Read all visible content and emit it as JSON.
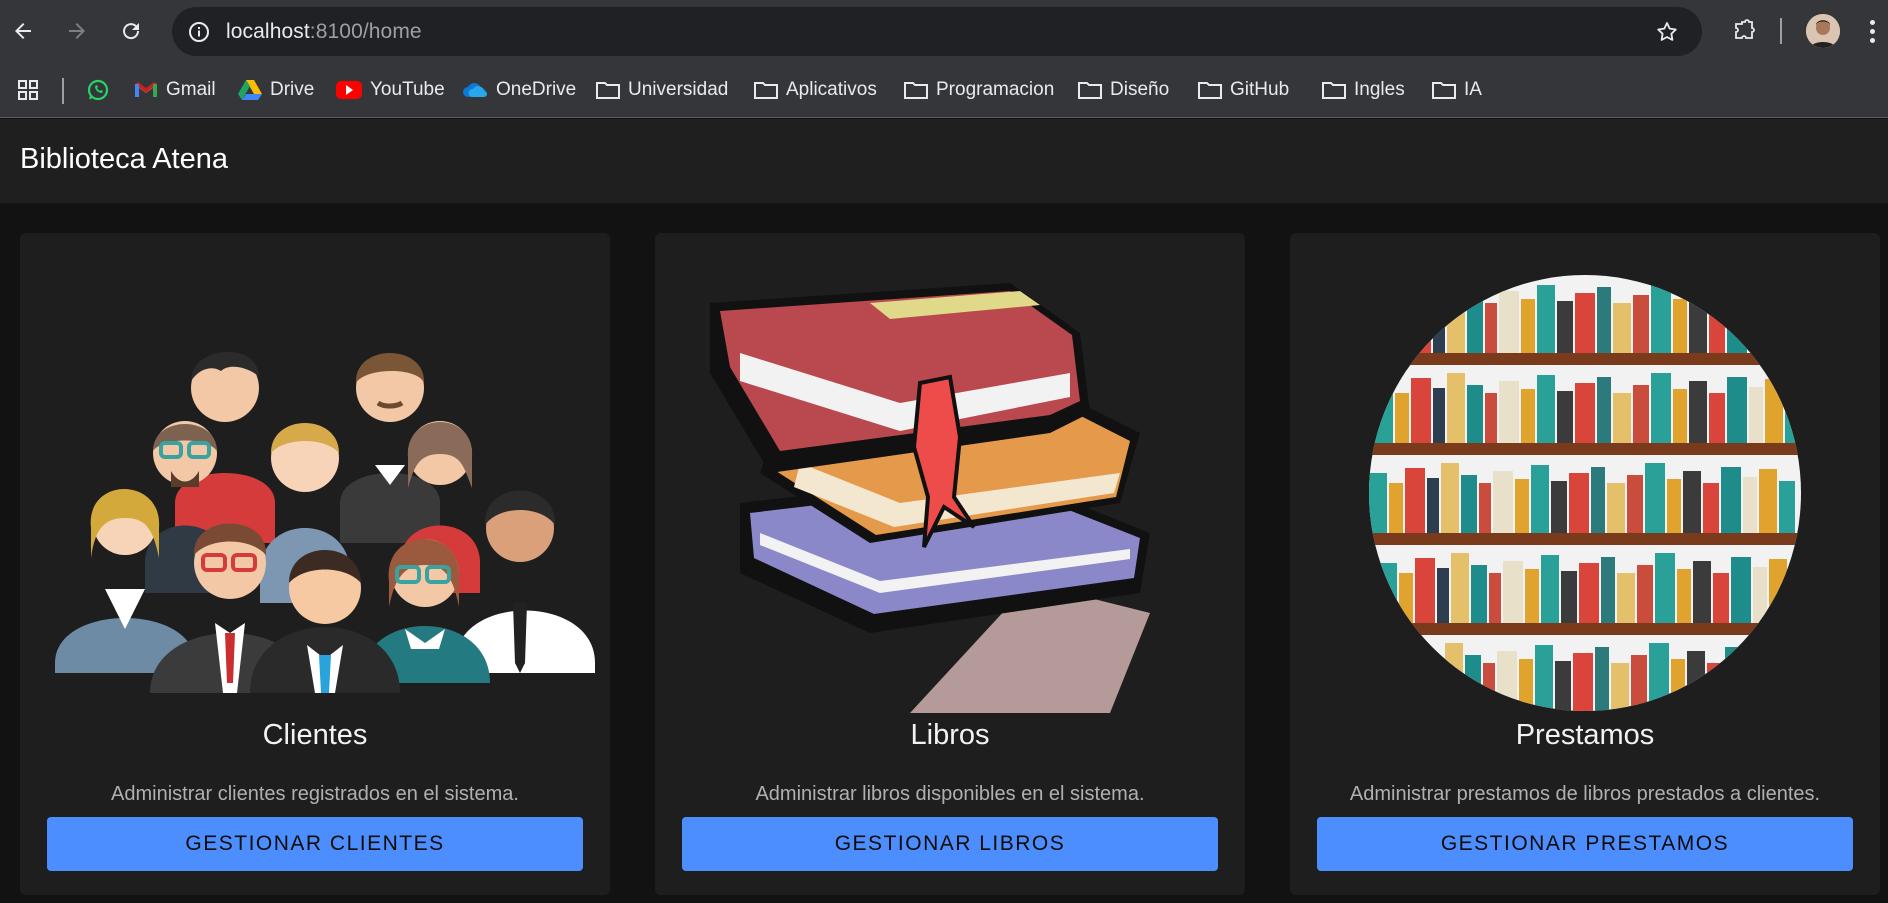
{
  "browser": {
    "url_host": "localhost",
    "url_path": ":8100/home",
    "bookmarks": [
      {
        "label": "",
        "icon": "whatsapp-icon"
      },
      {
        "label": "Gmail",
        "icon": "gmail-icon"
      },
      {
        "label": "Drive",
        "icon": "drive-icon"
      },
      {
        "label": "YouTube",
        "icon": "youtube-icon"
      },
      {
        "label": "OneDrive",
        "icon": "onedrive-icon"
      },
      {
        "label": "Universidad",
        "icon": "folder-icon"
      },
      {
        "label": "Aplicativos",
        "icon": "folder-icon"
      },
      {
        "label": "Programacion",
        "icon": "folder-icon"
      },
      {
        "label": "Diseño",
        "icon": "folder-icon"
      },
      {
        "label": "GitHub",
        "icon": "folder-icon"
      },
      {
        "label": "Ingles",
        "icon": "folder-icon"
      },
      {
        "label": "IA",
        "icon": "folder-icon"
      }
    ]
  },
  "app": {
    "title": "Biblioteca Atena"
  },
  "cards": [
    {
      "title": "Clientes",
      "subtitle": "Administrar clientes registrados en el sistema.",
      "button": "GESTIONAR CLIENTES",
      "image": "people-illustration"
    },
    {
      "title": "Libros",
      "subtitle": "Administrar libros disponibles en el sistema.",
      "button": "GESTIONAR LIBROS",
      "image": "books-stack-illustration"
    },
    {
      "title": "Prestamos",
      "subtitle": "Administrar prestamos de libros prestados a clientes.",
      "button": "GESTIONAR PRESTAMOS",
      "image": "bookshelf-illustration"
    }
  ],
  "colors": {
    "accent": "#4d8eff",
    "card_bg": "#1e1e1e",
    "page_bg": "#121212",
    "header_bg": "#1f1f1f"
  }
}
